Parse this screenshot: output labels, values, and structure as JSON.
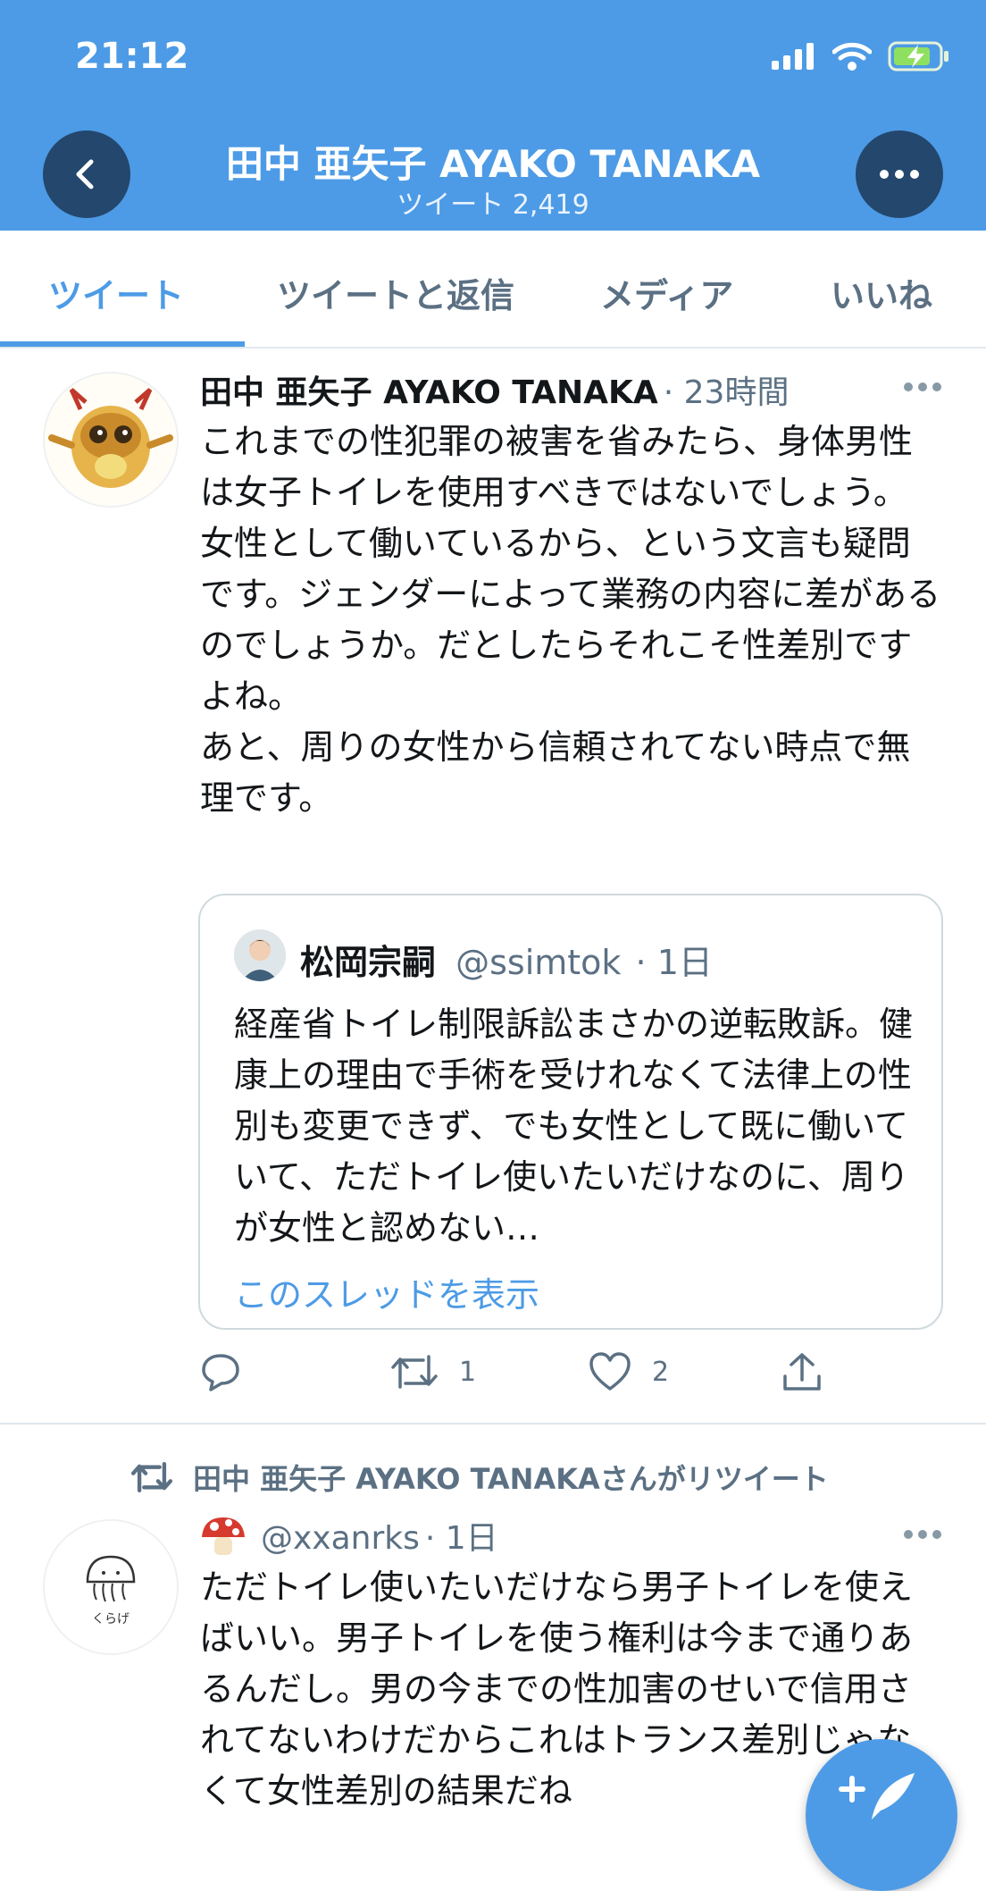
{
  "status_bar": {
    "time": "21:12"
  },
  "header": {
    "profile_name": "田中 亜矢子  AYAKO TANAKA",
    "tweet_count": "ツイート 2,419"
  },
  "tabs": [
    {
      "label": "ツイート",
      "active": true
    },
    {
      "label": "ツイートと返信",
      "active": false
    },
    {
      "label": "メディア",
      "active": false
    },
    {
      "label": "いいね",
      "active": false
    }
  ],
  "tweet1": {
    "author": "田中 亜矢子  AYAKO TANAKA",
    "time": "· 23時間",
    "text": "これまでの性犯罪の被害を省みたら、身体男性は女子トイレを使用すべきではないでしょう。\n女性として働いているから、という文言も疑問です。ジェンダーによって業務の内容に差があるのでしょうか。だとしたらそれこそ性差別ですよね。\nあと、周りの女性から信頼されてない時点で無理です。",
    "quote": {
      "author": "松岡宗嗣",
      "handle": "@ssimtok",
      "time": "· 1日",
      "text": "経産省トイレ制限訴訟まさかの逆転敗訴。健康上の理由で手術を受けれなくて法律上の性別も変更できず、でも女性として既に働いていて、ただトイレ使いたいだけなのに、周りが女性と認めない…",
      "link": "このスレッドを表示"
    },
    "actions": {
      "retweets": "1",
      "likes": "2"
    }
  },
  "tweet2": {
    "retweet_label": "田中 亜矢子  AYAKO TANAKAさんがリツイート",
    "avatar_caption": "くらげ",
    "handle": "@xxanrks",
    "time": "· 1日",
    "text": "ただトイレ使いたいだけなら男子トイレを使えばいい。男子トイレを使う権利は今まで通りあるんだし。男の今までの性加害のせいで信用されてないわけだからこれはトランス差別じゃなくて女性差別の結果だね"
  },
  "colors": {
    "accent": "#4d9be6",
    "header_dark_button": "#24476d",
    "muted": "#5b7083"
  }
}
